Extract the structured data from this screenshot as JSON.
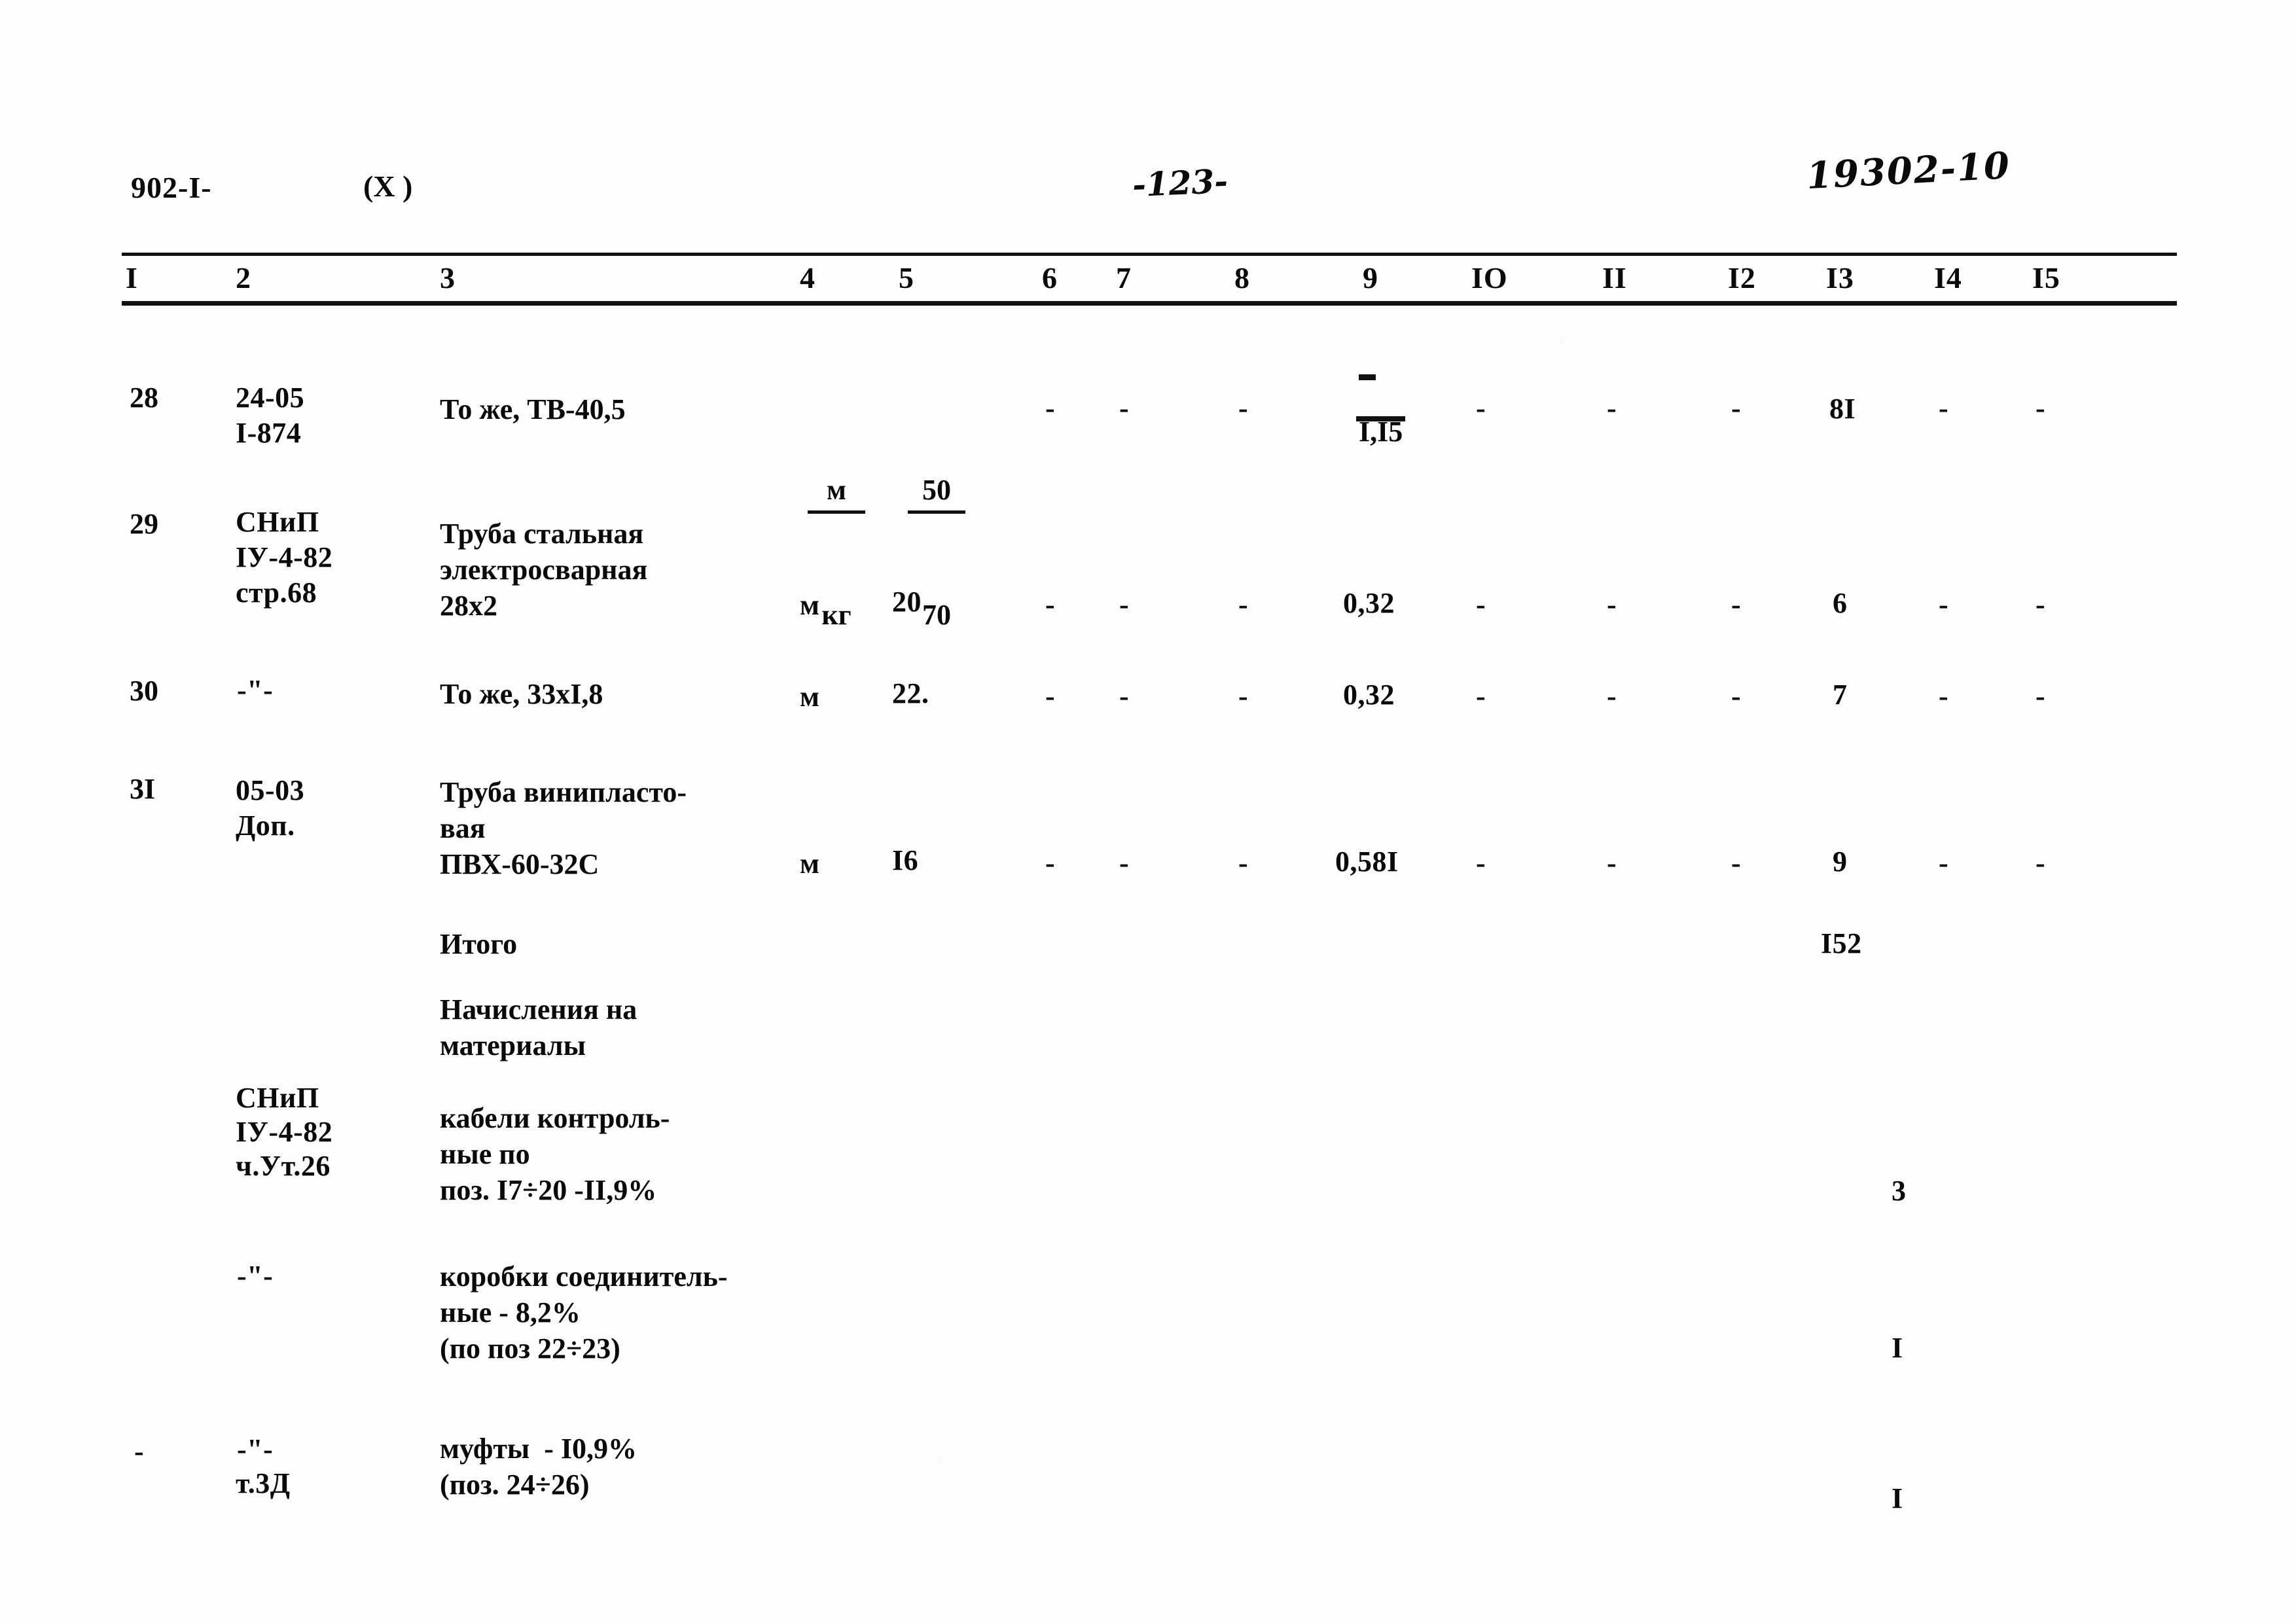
{
  "header": {
    "doc_code": "902-I-",
    "variant_mark": "(X )",
    "page_number": "-123-",
    "stamp": "19302-10"
  },
  "table": {
    "column_headers": [
      "I",
      "2",
      "3",
      "4",
      "5",
      "6",
      "7",
      "8",
      "9",
      "IO",
      "II",
      "I2",
      "I3",
      "I4",
      "I5"
    ],
    "rows": [
      {
        "pos": "28",
        "ref_lines": [
          "24-05",
          "I-874"
        ],
        "desc_lines": [
          "То же, ТВ-40,5"
        ],
        "unit_top": "м",
        "unit_bottom": "кг",
        "qty_top": "50",
        "qty_bottom": "70",
        "c6": "-",
        "c7": "-",
        "c8": "-",
        "c9": "I,I5",
        "c9_struck": true,
        "c10": "-",
        "c11": "-",
        "c12": "-",
        "c13": "8I",
        "c14": "-",
        "c15": "-"
      },
      {
        "pos": "29",
        "ref_lines": [
          "СНиП",
          "IУ-4-82",
          "стр.68"
        ],
        "desc_lines": [
          "Труба стальная",
          "электросварная",
          "28х2"
        ],
        "unit": "м",
        "qty": "20",
        "c6": "-",
        "c7": "-",
        "c8": "-",
        "c9": "0,32",
        "c10": "-",
        "c11": "-",
        "c12": "-",
        "c13": "6",
        "c14": "-",
        "c15": "-"
      },
      {
        "pos": "30",
        "ref_lines": [
          "-\"-"
        ],
        "desc_lines": [
          "То же, 33хI,8"
        ],
        "unit": "м",
        "qty": "22.",
        "c6": "-",
        "c7": "-",
        "c8": "-",
        "c9": "0,32",
        "c10": "-",
        "c11": "-",
        "c12": "-",
        "c13": "7",
        "c14": "-",
        "c15": "-"
      },
      {
        "pos": "3I",
        "ref_lines": [
          "05-03",
          "Доп."
        ],
        "desc_lines": [
          "Труба винипласто-",
          "вая",
          "ПВХ-60-32С"
        ],
        "unit": "м",
        "qty": "I6",
        "c6": "-",
        "c7": "-",
        "c8": "-",
        "c9": "0,58I",
        "c10": "-",
        "c11": "-",
        "c12": "-",
        "c13": "9",
        "c14": "-",
        "c15": "-"
      }
    ],
    "total": {
      "label": "Итого",
      "value": "I52"
    },
    "accruals_heading": [
      "Начисления на",
      "материалы"
    ],
    "accrual_rows": [
      {
        "ref_lines": [
          "СНиП",
          "IУ-4-82",
          "ч.Ут.26"
        ],
        "desc_lines": [
          "кабели контроль-",
          "ные по",
          "поз. I7÷20 -II,9%"
        ],
        "c13": "3"
      },
      {
        "ref_lines": [
          "-\"-"
        ],
        "desc_lines": [
          "коробки соединитель-",
          "ные - 8,2%",
          "(по поз 22÷23)"
        ],
        "c13": "I"
      },
      {
        "pos": "-",
        "ref_lines": [
          "-\"-",
          "т.3Д"
        ],
        "desc_lines": [
          "муфты  - I0,9%",
          "(поз. 24÷26)"
        ],
        "c13": "I"
      }
    ]
  }
}
